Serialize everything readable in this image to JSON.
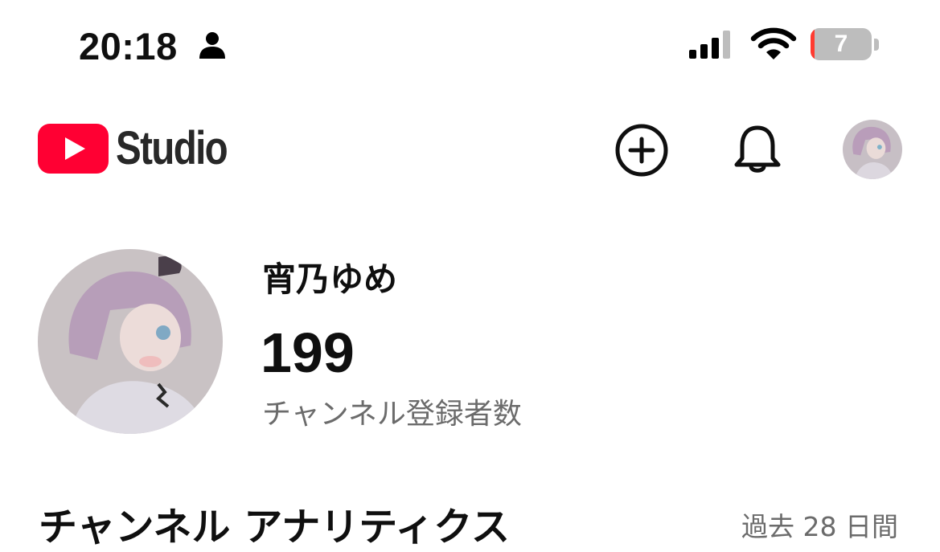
{
  "status_bar": {
    "time": "20:18",
    "battery_level": "7",
    "battery_fraction": 0.07,
    "icons": [
      "person-icon",
      "cellular-signal-icon",
      "wifi-icon",
      "battery-icon"
    ]
  },
  "header": {
    "app_name": "Studio",
    "logo_icon": "youtube-play-logo",
    "actions": [
      "create-plus-icon",
      "notifications-bell-icon",
      "account-avatar"
    ]
  },
  "channel": {
    "name": "宵乃ゆめ",
    "subscriber_count": "199",
    "subscriber_label": "チャンネル登録者数"
  },
  "analytics": {
    "title": "チャンネル アナリティクス",
    "period": "過去 28 日間"
  },
  "colors": {
    "brand_red": "#ff0033",
    "text_primary": "#0f0f0f",
    "text_secondary": "#6b6b6b",
    "battery_low": "#ff3b30",
    "battery_body": "#bdbdbd"
  }
}
